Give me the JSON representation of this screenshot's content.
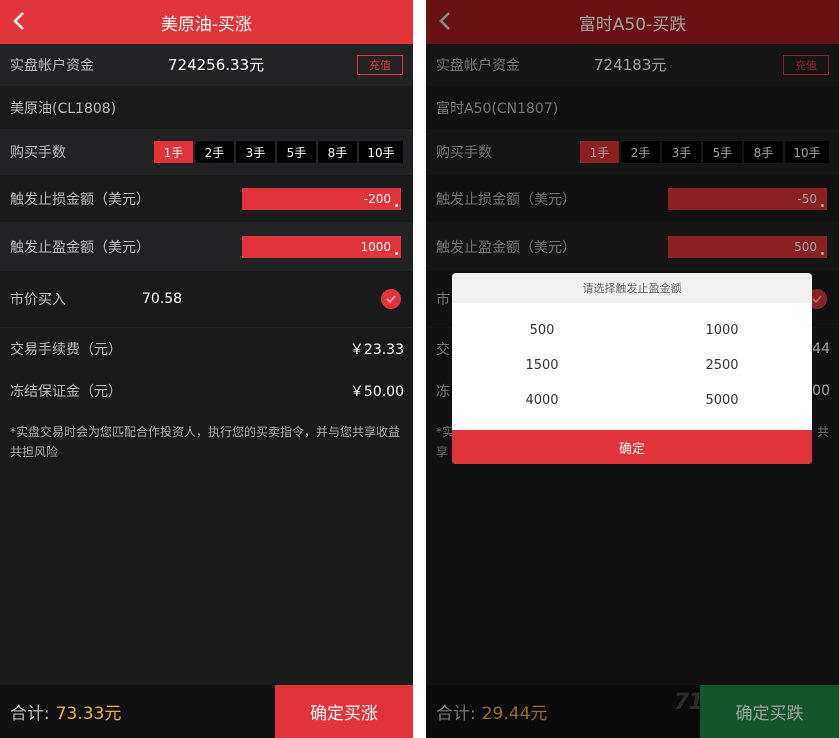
{
  "colors": {
    "accent": "#e0343a",
    "background": "#1a1a1b",
    "gold": "#f0b13a",
    "green": "#1f8a4a"
  },
  "left": {
    "title": "美原油-买涨",
    "account_label": "实盘帐户资金",
    "account_value": "724256.33元",
    "recharge_label": "充值",
    "product_code": "美原油(CL1808)",
    "lots_label": "购买手数",
    "lots": [
      "1手",
      "2手",
      "3手",
      "5手",
      "8手",
      "10手"
    ],
    "selected_lot": "1手",
    "stop_loss_label": "触发止损金额（美元）",
    "stop_loss_value": "-200",
    "take_profit_label": "触发止盈金额（美元）",
    "take_profit_value": "1000",
    "market_buy_label": "市价买入",
    "market_buy_price": "70.58",
    "fee_label": "交易手续费（元）",
    "fee_value": "￥23.33",
    "margin_label": "冻结保证金（元）",
    "margin_value": "￥50.00",
    "disclaimer": "*实盘交易时会为您匹配合作投资人，执行您的买卖指令，并与您共享收益共担风险",
    "total_label": "合计:",
    "total_value": "73.33元",
    "confirm_label": "确定买涨",
    "header_color": "#e0343a",
    "confirm_color": "#e0343a"
  },
  "right": {
    "title": "富时A50-买跌",
    "account_label": "实盘帐户资金",
    "account_value": "724183元",
    "recharge_label": "充值",
    "product_code": "富时A50(CN1807)",
    "lots_label": "购买手数",
    "lots": [
      "1手",
      "2手",
      "3手",
      "5手",
      "8手",
      "10手"
    ],
    "selected_lot": "1手",
    "stop_loss_label": "触发止损金额（美元）",
    "stop_loss_value": "-50",
    "take_profit_label": "触发止盈金额（美元）",
    "take_profit_value": "500",
    "market_buy_label": "市",
    "fee_label": "交",
    "fee_value": "44",
    "margin_label": "冻",
    "margin_value": "00",
    "disclaimer_line1": "*实",
    "disclaimer_line1_end": "共",
    "disclaimer_line2": "享",
    "total_label": "合计:",
    "total_value": "29.44元",
    "confirm_label": "确定买跌",
    "watermark": "71",
    "header_color": "#a81e22",
    "confirm_color": "#1f8a4a",
    "modal": {
      "title": "请选择触发止盈金额",
      "options": [
        "500",
        "1000",
        "1500",
        "2500",
        "4000",
        "5000"
      ],
      "ok_label": "确定"
    }
  }
}
